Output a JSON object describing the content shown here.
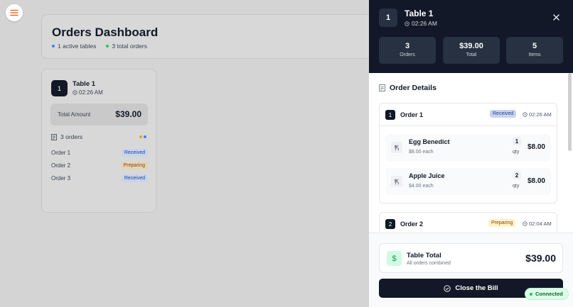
{
  "dashboard": {
    "title": "Orders Dashboard",
    "active_tables": "1 active tables",
    "total_orders": "3 total orders",
    "colors": {
      "active_dot": "#3b82f6",
      "orders_dot": "#22c55e"
    }
  },
  "table_card": {
    "number": "1",
    "name": "Table 1",
    "time": "02:26 AM",
    "total_label": "Total Amount",
    "total_value": "$39.00",
    "orders_count": "3 orders",
    "orders": [
      {
        "label": "Order 1",
        "status": "Received"
      },
      {
        "label": "Order 2",
        "status": "Preparing"
      },
      {
        "label": "Order 3",
        "status": "Received"
      }
    ]
  },
  "panel": {
    "number": "1",
    "title": "Table 1",
    "time": "02:26 AM",
    "stats": [
      {
        "value": "3",
        "label": "Orders"
      },
      {
        "value": "$39.00",
        "label": "Total"
      },
      {
        "value": "5",
        "label": "Items"
      }
    ],
    "order_details_title": "Order Details",
    "orders": [
      {
        "number": "1",
        "name": "Order 1",
        "status": "Received",
        "time": "02:26 AM",
        "items": [
          {
            "name": "Egg Benedict",
            "unit_price": "$8.00 each",
            "qty": "1",
            "qty_label": "qty",
            "amount": "$8.00"
          },
          {
            "name": "Apple Juice",
            "unit_price": "$4.00 each",
            "qty": "2",
            "qty_label": "qty",
            "amount": "$8.00"
          }
        ]
      },
      {
        "number": "2",
        "name": "Order 2",
        "status": "Preparing",
        "time": "02:04 AM"
      }
    ],
    "table_total_title": "Table Total",
    "table_total_sub": "All orders combined",
    "table_total_value": "$39.00",
    "close_bill_label": "Close the Bill"
  },
  "connection": {
    "status": "Connected",
    "color": "#22c55e"
  }
}
